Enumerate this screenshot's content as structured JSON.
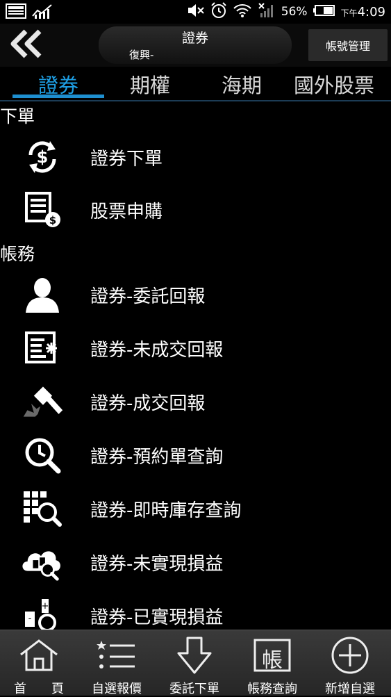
{
  "status_bar": {
    "battery_percent": "56%",
    "time_prefix": "下午",
    "time": "4:09",
    "icons": [
      "gallery-icon",
      "stock-app-icon",
      "mute-icon",
      "alarm-icon",
      "wifi-icon",
      "signal-icon",
      "battery-icon"
    ]
  },
  "header": {
    "back_icon": "double-chevron-left-icon",
    "title": "證券",
    "subtitle": "復興-",
    "account_button": "帳號管理"
  },
  "tabs": [
    {
      "label": "證券",
      "active": true
    },
    {
      "label": "期權",
      "active": false
    },
    {
      "label": "海期",
      "active": false
    },
    {
      "label": "國外股票",
      "active": false
    }
  ],
  "sections": [
    {
      "title": "下單",
      "items": [
        {
          "label": "證券下單",
          "icon": "dollar-cycle-icon"
        },
        {
          "label": "股票申購",
          "icon": "document-dollar-icon"
        }
      ]
    },
    {
      "title": "帳務",
      "items": [
        {
          "label": "證券-委託回報",
          "icon": "person-icon"
        },
        {
          "label": "證券-未成交回報",
          "icon": "document-star-icon"
        },
        {
          "label": "證券-成交回報",
          "icon": "gavel-icon"
        },
        {
          "label": "證券-預約單查詢",
          "icon": "clock-search-icon"
        },
        {
          "label": "證券-即時庫存查詢",
          "icon": "grid-search-icon"
        },
        {
          "label": "證券-未實現損益",
          "icon": "cloud-search-icon"
        },
        {
          "label": "證券-已實現損益",
          "icon": "plus-minus-search-icon"
        }
      ]
    }
  ],
  "bottom_nav": [
    {
      "label": "首　　頁",
      "icon": "home-icon"
    },
    {
      "label": "自選報價",
      "icon": "list-icon"
    },
    {
      "label": "委託下單",
      "icon": "arrow-down-icon"
    },
    {
      "label": "帳務查詢",
      "icon": "ledger-icon",
      "icon_text": "帳"
    },
    {
      "label": "新增自選",
      "icon": "plus-circle-icon"
    }
  ]
}
